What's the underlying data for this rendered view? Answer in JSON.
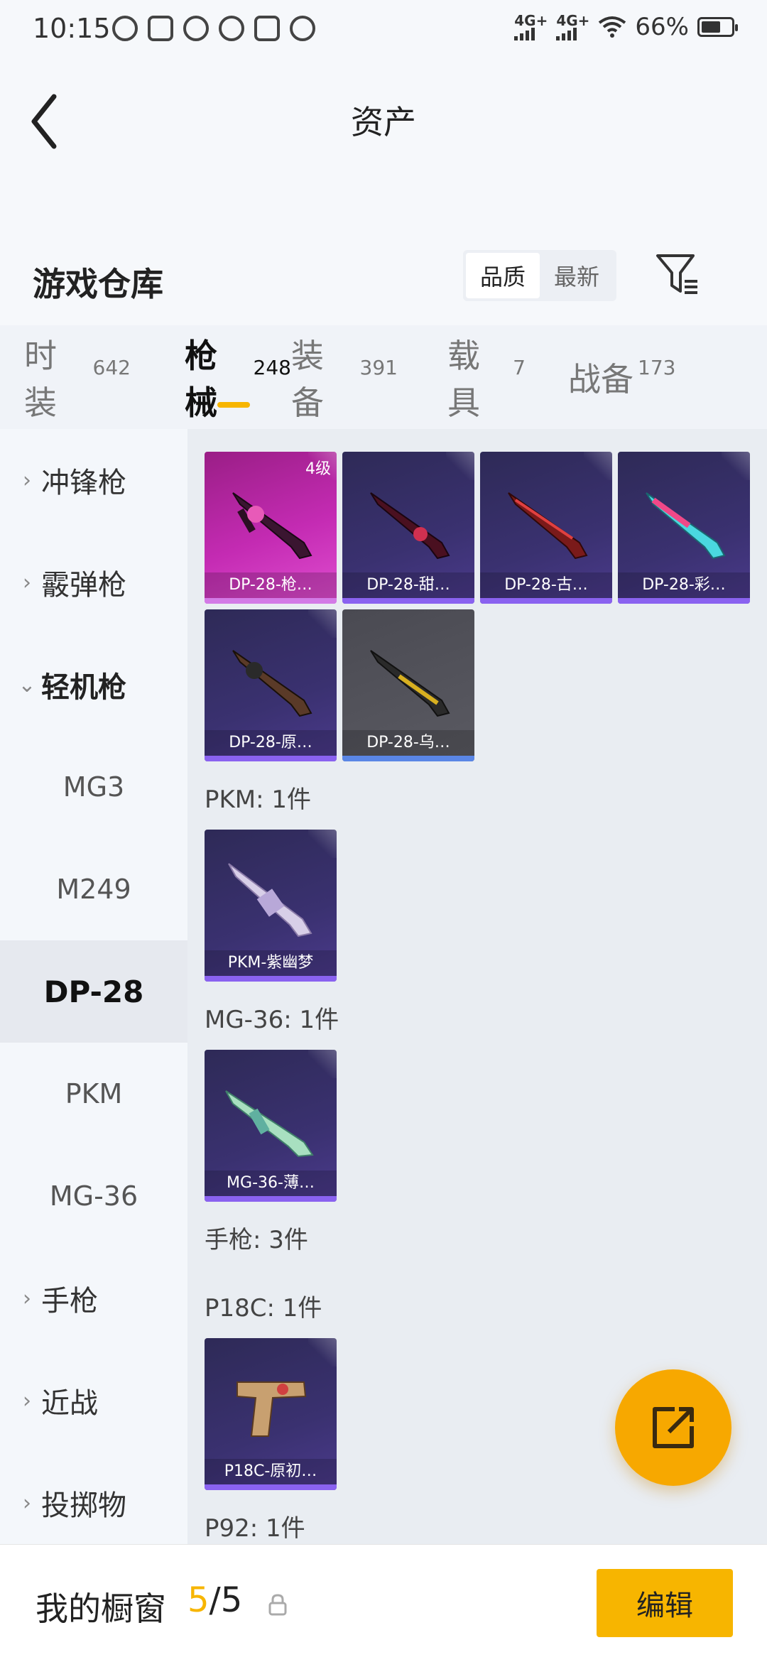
{
  "status": {
    "time": "10:15",
    "network1": "4G+",
    "network2": "4G+",
    "battery": "66%",
    "battery_level": 0.66
  },
  "header": {
    "title": "资产"
  },
  "warehouse": {
    "title": "游戏仓库",
    "sort_options": [
      "品质",
      "最新"
    ],
    "active_sort": "品质"
  },
  "tabs": [
    {
      "label": "时装",
      "count": "642"
    },
    {
      "label": "枪械",
      "count": "248"
    },
    {
      "label": "装备",
      "count": "391"
    },
    {
      "label": "载具",
      "count": "7"
    },
    {
      "label": "战备",
      "count": "173"
    }
  ],
  "side_nav": [
    {
      "label": "冲锋枪",
      "type": "category",
      "state": "collapsed"
    },
    {
      "label": "霰弹枪",
      "type": "category",
      "state": "collapsed"
    },
    {
      "label": "轻机枪",
      "type": "category",
      "state": "expanded"
    },
    {
      "label": "MG3",
      "type": "sub"
    },
    {
      "label": "M249",
      "type": "sub"
    },
    {
      "label": "DP-28",
      "type": "sub",
      "selected": true
    },
    {
      "label": "PKM",
      "type": "sub"
    },
    {
      "label": "MG-36",
      "type": "sub"
    },
    {
      "label": "手枪",
      "type": "category",
      "state": "collapsed"
    },
    {
      "label": "近战",
      "type": "category",
      "state": "collapsed"
    },
    {
      "label": "投掷物",
      "type": "category",
      "state": "collapsed"
    }
  ],
  "items": {
    "dp28": [
      {
        "name": "DP-28-枪…",
        "level": "4级",
        "rarity": "pink"
      },
      {
        "name": "DP-28-甜…",
        "rarity": "purple"
      },
      {
        "name": "DP-28-古…",
        "rarity": "purple"
      },
      {
        "name": "DP-28-彩…",
        "rarity": "purple"
      },
      {
        "name": "DP-28-原…",
        "rarity": "purple"
      },
      {
        "name": "DP-28-乌…",
        "rarity": "gray"
      }
    ],
    "pkm_label": "PKM: 1件",
    "pkm": [
      {
        "name": "PKM-紫幽梦",
        "rarity": "purple"
      }
    ],
    "mg36_label": "MG-36: 1件",
    "mg36": [
      {
        "name": "MG-36-薄…",
        "rarity": "purple"
      }
    ],
    "pistol_label": "手枪: 3件",
    "p18c_label": "P18C: 1件",
    "p18c": [
      {
        "name": "P18C-原初…",
        "rarity": "purple"
      }
    ],
    "p92_label": "P92: 1件"
  },
  "bottom": {
    "title": "我的橱窗",
    "count_current": "5",
    "count_total": "/5",
    "edit_label": "编辑"
  },
  "colors": {
    "accent": "#f7b500",
    "fab": "#f7a800",
    "card_purple": "#3a3170",
    "card_pink": "#c42bb3"
  }
}
